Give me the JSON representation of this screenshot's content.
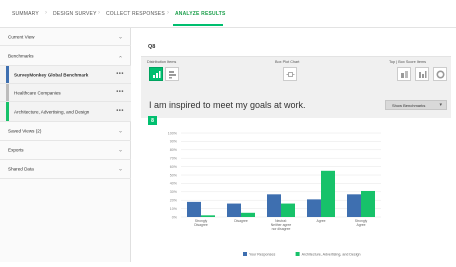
{
  "nav": {
    "steps": [
      "SUMMARY",
      "DESIGN SURVEY",
      "COLLECT RESPONSES",
      "ANALYZE RESULTS"
    ],
    "separator": "›"
  },
  "sidebar": {
    "current_view": "Current View",
    "benchmarks": "Benchmarks",
    "benchmark_items": [
      "SurveyMonkey Global Benchmark",
      "Healthcare Companies",
      "Architecture, Advertising, and Design"
    ],
    "saved_views": "Saved Views (2)",
    "exports": "Exports",
    "shared_data": "Shared Data",
    "more_glyph": "•••"
  },
  "question": {
    "label": "Q8",
    "title": "I am inspired to meet my goals at work.",
    "flag": "8"
  },
  "toolbar": {
    "distribution_title": "Distribution Items",
    "pie_title": "Box Plot Chart",
    "topbox_title": "Top | Box Score Items"
  },
  "show_benchmarks": {
    "label": "Show Benchmarks",
    "caret": "▾"
  },
  "colors": {
    "series1": "#3e6fb0",
    "series2": "#17c26a",
    "accent": "#00bf6f"
  },
  "chart_data": {
    "type": "bar",
    "categories": [
      "Strongly Disagree",
      "Disagree",
      "Neutral: Neither agree nor disagree",
      "Agree",
      "Strongly Agree"
    ],
    "category_lines": [
      [
        "Strongly",
        "Disagree"
      ],
      [
        "Disagree"
      ],
      [
        "Neutral:",
        "Neither agree",
        "nor disagree"
      ],
      [
        "Agree"
      ],
      [
        "Strongly",
        "Agree"
      ]
    ],
    "series": [
      {
        "name": "Your Responses",
        "values": [
          18,
          16,
          27,
          21,
          27
        ]
      },
      {
        "name": "Architecture, Advertising, and Design",
        "values": [
          2,
          5,
          16,
          55,
          31
        ]
      }
    ],
    "ylim": [
      0,
      100
    ],
    "yticks": [
      "0%",
      "10%",
      "20%",
      "30%",
      "40%",
      "50%",
      "60%",
      "70%",
      "80%",
      "90%",
      "100%"
    ],
    "grid": true,
    "legend": "bottom"
  }
}
